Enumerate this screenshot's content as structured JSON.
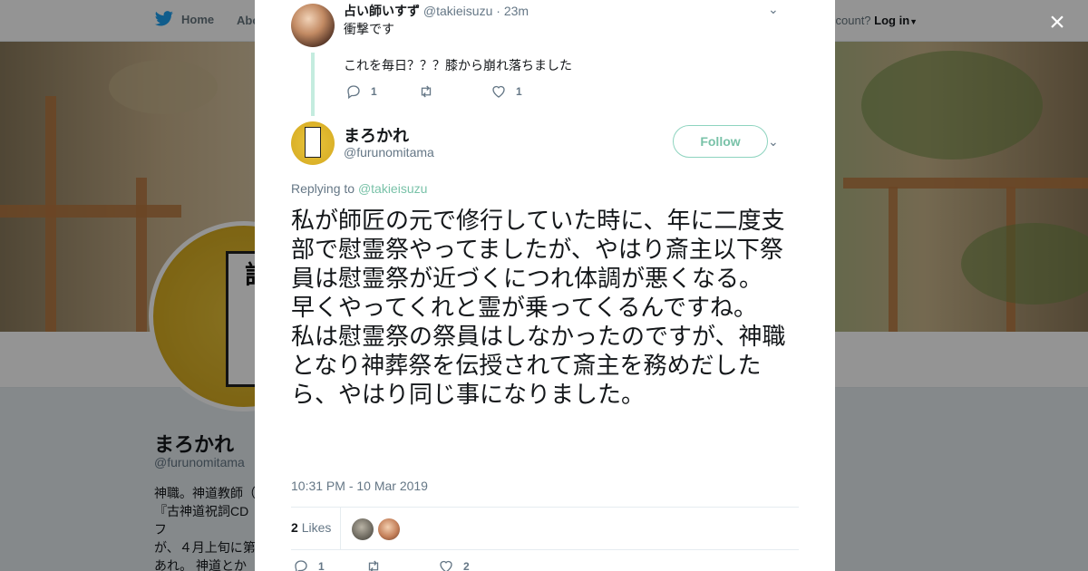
{
  "nav": {
    "home_label": "Home",
    "about_label": "Abo",
    "login_prompt": "ccount?",
    "login_label": "Log in"
  },
  "profile": {
    "name": "まろかれ",
    "handle": "@furunomitama",
    "bio": "神職。神道教師（\n『古神道祝詞CDフ\nが、４月上旬に第\nあれ。 神道とか密\nに反応します。道",
    "avatar_text": "古神道祝詞"
  },
  "modal": {
    "close_label": "×",
    "reply_tweet": {
      "name": "占い師いすず",
      "handle": "@takieisuzu",
      "time": "23m",
      "line1": "衝撃です",
      "line2": "これを毎日？？？膝から崩れ落ちました",
      "reply_count": "1",
      "retweet_count": "",
      "like_count": "1"
    },
    "main_tweet": {
      "name": "まろかれ",
      "handle": "@furunomitama",
      "follow_label": "Follow",
      "replying_prefix": "Replying to",
      "replying_to": "@takieisuzu",
      "text_p1": "私が師匠の元で修行していた時に、年に二度支部で慰霊祭やってましたが、やはり斎主以下祭員は慰霊祭が近づくにつれ体調が悪くなる。",
      "text_p2": "早くやってくれと霊が乗ってくるんですね。",
      "text_p3": "私は慰霊祭の祭員はしなかったのですが、神職となり神葬祭を伝授されて斎主を務めだしたら、やはり同じ事になりました。",
      "timestamp": "10:31 PM - 10 Mar 2019",
      "likes_count": "2",
      "likes_label": "Likes",
      "reply_count": "1",
      "retweet_count": "",
      "like_count": "2"
    }
  }
}
